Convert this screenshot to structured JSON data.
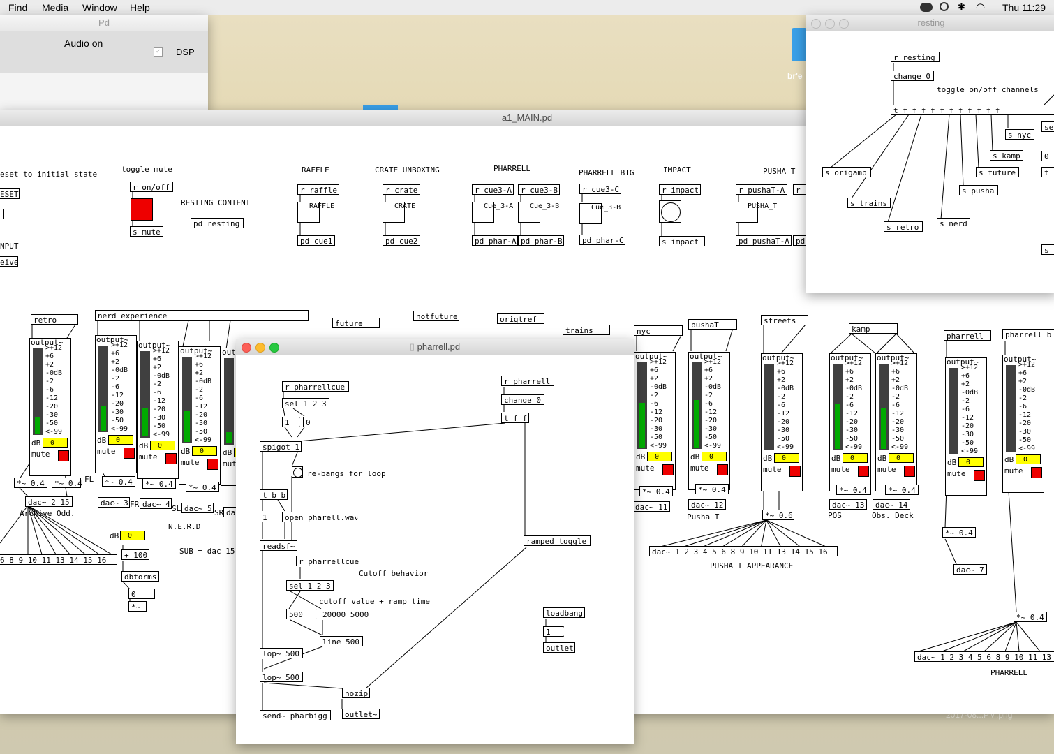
{
  "menubar": {
    "items": [
      "Find",
      "Media",
      "Window",
      "Help"
    ],
    "clock": "Thu 11:29 P"
  },
  "pd_window": {
    "title": "Pd",
    "audio_on": "Audio on",
    "dsp_label": "DSP"
  },
  "desktop": {
    "label": "br'e",
    "file_label": "2017-08...PM.png"
  },
  "main_window": {
    "title": "a1_MAIN.pd",
    "comments": {
      "reset": "eset to initial state",
      "toggle_mute": "toggle mute",
      "resting_content": "RESTING CONTENT",
      "raffle": "RAFFLE",
      "crate": "CRATE UNBOXING",
      "pharrell": "PHARRELL",
      "pharrell_big": "PHARRELL BIG",
      "impact": "IMPACT",
      "pusha_t": "PUSHA T",
      "nput": "NPUT",
      "archive": "Archive Odd.",
      "fl": "FL",
      "fr": "FR",
      "sl": "SL",
      "sr": "SR",
      "nerd": "N.E.R.D",
      "sub": "SUB = dac 15",
      "db": "dB",
      "pusha_t_lbl": "Pusha T",
      "pos": "POS",
      "obs_deck": "Obs. Deck",
      "pusha_appearance": "PUSHA T APPEARANCE",
      "pharrell_lbl": "PHARRELL"
    },
    "objects": {
      "reset": "ESET",
      "eive": "eive",
      "r_onoff": "r on/off",
      "s_mute": "s mute",
      "pd_resting": "pd resting",
      "r_raffle": "r raffle",
      "raffle_b": "RAFFLE",
      "pd_cue1": "pd cue1",
      "r_crate": "r crate",
      "crate_b": "CRATE",
      "pd_cue2": "pd cue2",
      "r_cue3a": "r cue3-A",
      "cue3a_b": "Cue_3-A",
      "pd_phara": "pd phar-A",
      "r_cue3b": "r cue3-B",
      "cue3b_b": "Cue_3-B",
      "pd_pharb": "pd phar-B",
      "r_cue3c": "r cue3-C",
      "cue3c_b": "Cue_3-B",
      "pd_pharc": "pd phar-C",
      "r_impact": "r impact",
      "s_impact": "s impact",
      "r_pushata": "r pushaT-A",
      "pushat_b": "PUSHA_T",
      "pd_pushata": "pd pushaT-A",
      "r_p": "r p",
      "pd_p": "pd",
      "retro": "retro",
      "nerd_exp": "nerd_experience",
      "future": "future",
      "notfuture": "notfuture",
      "origtref": "origtref",
      "trains": "trains",
      "nyc": "nyc",
      "pushat": "pushaT",
      "streets": "streets",
      "kamp": "kamp",
      "pharrell": "pharrell",
      "pharrell_b": "pharrell_b",
      "mul04": "*~ 0.4",
      "mul06": "*~ 0.6",
      "dac_2_15": "dac~ 2 15",
      "dac_3": "dac~ 3",
      "dac_4": "dac~ 4",
      "dac_5": "dac~ 5",
      "dac_11": "dac~ 11",
      "dac_12": "dac~ 12",
      "dac_13": "dac~ 13",
      "dac_14": "dac~ 14",
      "dac_7": "dac~ 7",
      "dac_left": "6 8 9 10 11 13 14 15 16",
      "dac_pusha": "dac~ 1 2 3 4 5 6 8 9 10 11 13 14 15 16",
      "dac_pharrell": "dac~ 1 2 3 4 5 6 8 9 10 11 13",
      "plus100": "+ 100",
      "dbtorms": "dbtorms",
      "zero": "0",
      "mul_tilde": "*~",
      "da": "da"
    },
    "vu": {
      "output_label": "output~",
      "scale": [
        ">+12",
        "+6",
        "+2",
        "-0dB",
        "-2",
        "-6",
        "-12",
        "-20",
        "-30",
        "-50",
        "<-99"
      ],
      "db_label": "dB",
      "db_value": "0",
      "mute_label": "mute"
    }
  },
  "resting_window": {
    "title": "resting",
    "comment": "toggle on/off channels",
    "objects": {
      "r_resting": "r resting",
      "change0": "change 0",
      "tf": "t f f f f f f f f f f f",
      "s_nyc": "s nyc",
      "s_kamp": "s kamp",
      "s_future": "s future",
      "s_origamb": "s origamb",
      "s_pusha": "s pusha",
      "s_trains": "s trains",
      "s_nerd": "s nerd",
      "s_retro": "s retro",
      "s_se": "se",
      "s_cut1": "t",
      "s_cut2": "0",
      "s_cut3": "s"
    }
  },
  "pharrell_window": {
    "title": "pharrell.pd",
    "objects": {
      "r_pharrellcue": "r pharrellcue",
      "sel123": "sel 1 2 3",
      "msg1": "1",
      "msg0": "0",
      "spigot": "spigot 1",
      "tbb": "t b b",
      "msg1b": "1",
      "open": "open pharell.wav",
      "readsf": "readsf~",
      "r_pharrellcue2": "r pharrellcue",
      "sel123b": "sel 1 2 3",
      "msg500": "500 0",
      "msg20000": "20000 5000",
      "line500": "line 500",
      "lop1": "lop~ 500",
      "lop2": "lop~ 500",
      "send": "send~ pharbigg",
      "nozip": "nozip",
      "outlet_sig": "outlet~",
      "r_pharrell": "r pharrell",
      "change0": "change 0",
      "tff": "t f f",
      "ramped": "ramped_toggle",
      "loadbang": "loadbang",
      "msg1c": "1",
      "outlet": "outlet"
    },
    "comments": {
      "rebangs": "re-bangs for loop",
      "cutoff": "Cutoff behavior",
      "cutoff_val": "cutoff value + ramp time"
    }
  },
  "colors": {
    "toggle_red": "#e00000",
    "number_yellow": "#ffff00",
    "meter_green": "#00aa00"
  }
}
